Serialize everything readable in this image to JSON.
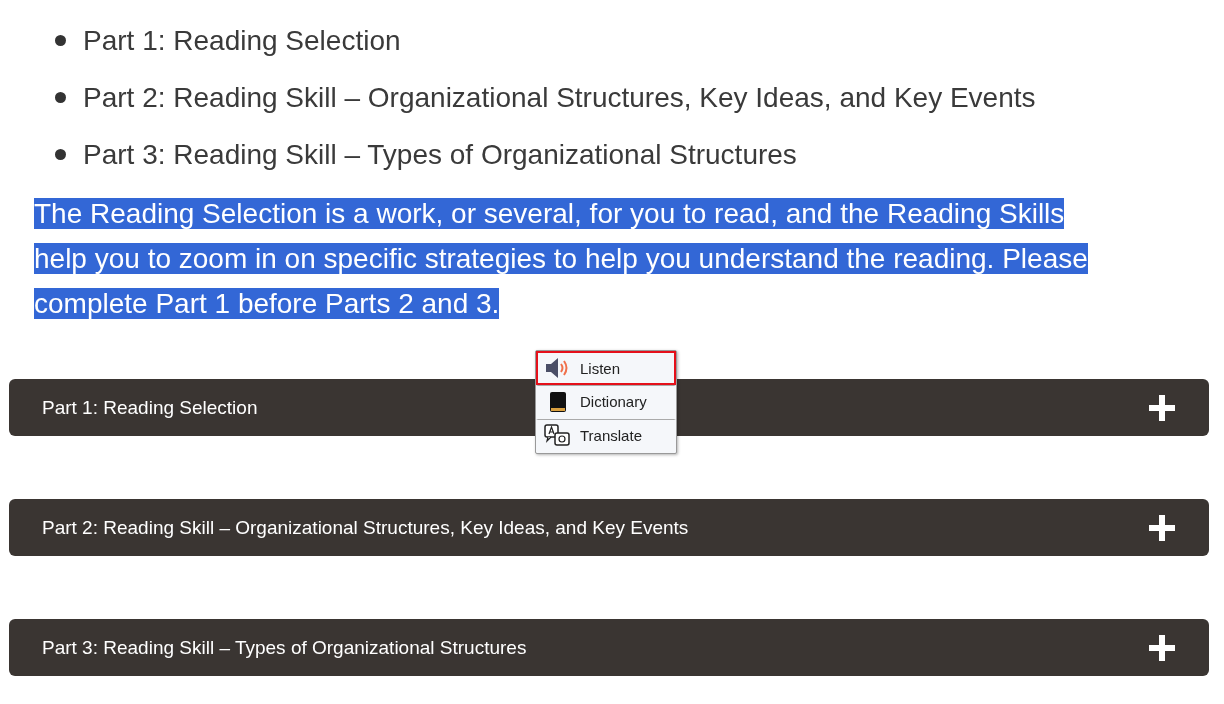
{
  "parts_list": [
    "Part 1: Reading Selection",
    "Part 2: Reading Skill – Organizational Structures, Key Ideas, and Key Events",
    "Part 3: Reading Skill – Types of Organizational Structures"
  ],
  "intro": {
    "text": "The Reading Selection is a work, or several, for you to read, and the Reading Skills help you to zoom in on specific strategies to help you understand the reading. Please complete Part 1 before Parts 2 and 3.",
    "highlighted": true
  },
  "context_menu": [
    {
      "kind": "listen",
      "label": "Listen",
      "selected": true
    },
    {
      "kind": "dictionary",
      "label": "Dictionary",
      "selected": false
    },
    {
      "kind": "translate",
      "label": "Translate",
      "selected": false
    }
  ],
  "accordions": [
    {
      "title": "Part 1: Reading Selection",
      "expanded": false
    },
    {
      "title": "Part 2: Reading Skill – Organizational Structures, Key Ideas, and Key Events",
      "expanded": false
    },
    {
      "title": "Part 3: Reading Skill – Types of Organizational Structures",
      "expanded": false
    }
  ]
}
